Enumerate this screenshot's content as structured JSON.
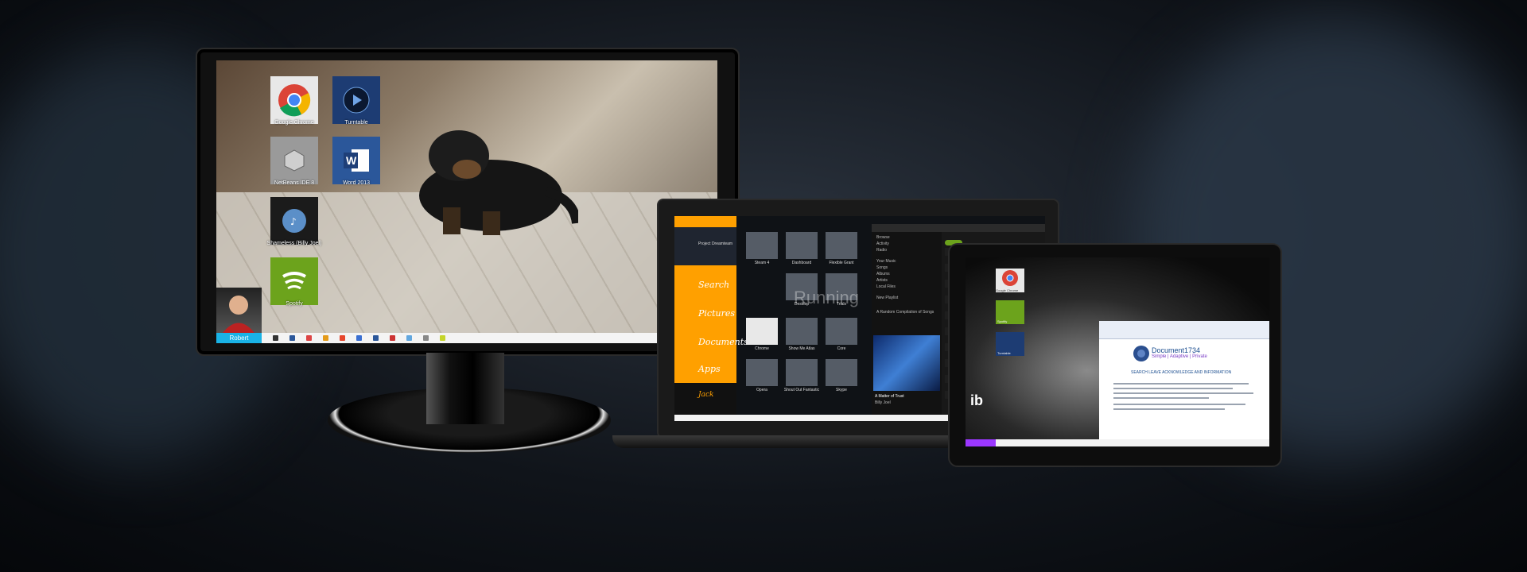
{
  "monitor": {
    "desktop_tiles": [
      {
        "label": "Google Chrome",
        "icon": "chrome-icon",
        "color": "#e8e8e8"
      },
      {
        "label": "Turntable",
        "icon": "turntable-icon",
        "color": "#1d3c73"
      },
      {
        "label": "NetBeans IDE 8",
        "icon": "netbeans-icon",
        "color": "#9a9a9a"
      },
      {
        "label": "Word 2013",
        "icon": "word-icon",
        "color": "#2b579a"
      },
      {
        "label": "Shameless (Billy Joel)",
        "icon": "music-icon",
        "color": "#1b1b1b"
      },
      {
        "label": "Spotify",
        "icon": "spotify-icon",
        "color": "#6ca31c"
      }
    ],
    "user_name": "Robert",
    "taskbar_icon_colors": [
      "#333",
      "#2b579a",
      "#d44",
      "#e49b1a",
      "#e6462c",
      "#3a6fd1",
      "#2b579a",
      "#c33",
      "#62a7df",
      "#888",
      "#c5d52b"
    ]
  },
  "laptop": {
    "menu": [
      "Search",
      "Pictures",
      "Documents",
      "Apps"
    ],
    "project_title": "Project Dreamteam",
    "tiles": [
      "Steam 4",
      "Dashboard",
      "Flexible Grant",
      "Desktop",
      "Trials",
      "Chrome",
      "Show Me Atlas",
      "Core",
      "Opera",
      "Shout Out Fantastic",
      "Skype"
    ],
    "running_label": "Running",
    "user_label": "Jack",
    "spotify": {
      "nav": [
        "Browse",
        "Activity",
        "Radio",
        "Your Music",
        "Songs",
        "Albums",
        "Artists",
        "Local Files",
        "New Playlist"
      ],
      "now_playing": "A Matter of Trust",
      "artist": "Billy Joel",
      "playlist": "A Random Compilation of Songs"
    }
  },
  "tablet": {
    "start_tiles": [
      {
        "label": "Google Chrome",
        "color": "#e8e8e8"
      },
      {
        "label": "Spotify",
        "color": "#6ca31c"
      },
      {
        "label": "Turntable",
        "color": "#1d3c73"
      }
    ],
    "doc_brand": "Document1734",
    "doc_sub": "Simple | Adaptive | Private",
    "doc_heading": "SEARCH LEAVE ACKNOWLEDGE AND INFORMATION",
    "logo": "ib",
    "accent": "#9b37ff"
  }
}
